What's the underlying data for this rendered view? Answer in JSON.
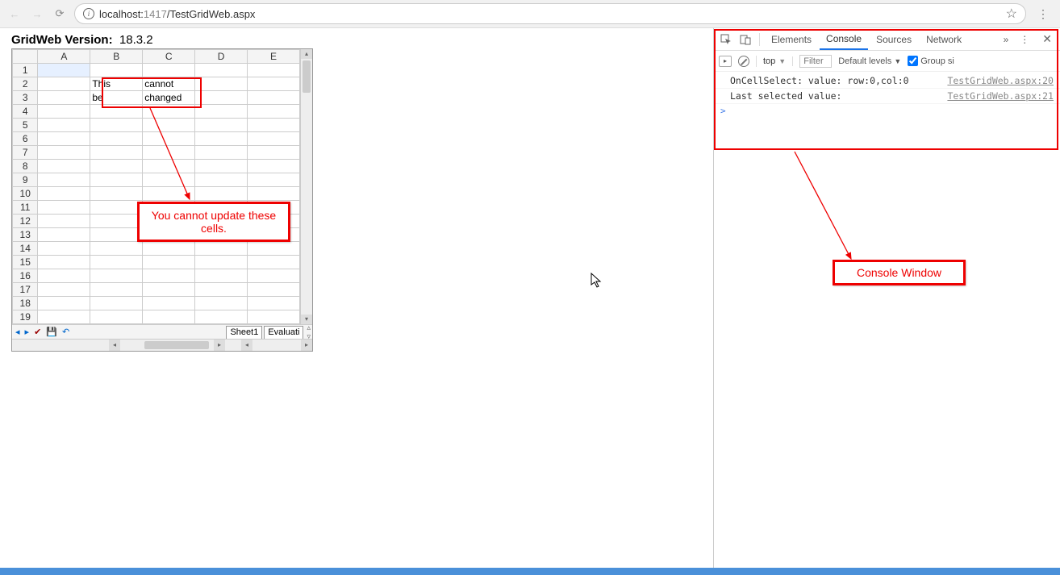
{
  "browser": {
    "url_host": "localhost:",
    "url_port": "1417",
    "url_path": "/TestGridWeb.aspx"
  },
  "page": {
    "version_label": "GridWeb Version:",
    "version_value": "18.3.2"
  },
  "grid": {
    "columns": [
      "A",
      "B",
      "C",
      "D",
      "E"
    ],
    "rows": [
      {
        "n": "1",
        "A": "",
        "B": "",
        "C": "",
        "D": "",
        "E": "",
        "sel": true
      },
      {
        "n": "2",
        "A": "",
        "B": "This",
        "C": "cannot",
        "D": "",
        "E": ""
      },
      {
        "n": "3",
        "A": "",
        "B": "be",
        "C": "changed",
        "D": "",
        "E": ""
      },
      {
        "n": "4"
      },
      {
        "n": "5"
      },
      {
        "n": "6"
      },
      {
        "n": "7"
      },
      {
        "n": "8"
      },
      {
        "n": "9"
      },
      {
        "n": "10"
      },
      {
        "n": "11"
      },
      {
        "n": "12"
      },
      {
        "n": "13"
      },
      {
        "n": "14"
      },
      {
        "n": "15"
      },
      {
        "n": "16"
      },
      {
        "n": "17"
      },
      {
        "n": "18"
      },
      {
        "n": "19"
      }
    ],
    "tabs": [
      "Sheet1",
      "Evaluati"
    ]
  },
  "annotations": {
    "cells_note": "You cannot update these cells.",
    "console_note": "Console  Window"
  },
  "devtools": {
    "tabs": [
      "Elements",
      "Console",
      "Sources",
      "Network"
    ],
    "active_tab": "Console",
    "context": "top",
    "filter_placeholder": "Filter",
    "levels_label": "Default levels",
    "group_label": "Group si",
    "log": [
      {
        "msg": "OnCellSelect: value: row:0,col:0",
        "src": "TestGridWeb.aspx:20"
      },
      {
        "msg": "Last selected value:",
        "src": "TestGridWeb.aspx:21"
      }
    ],
    "prompt": ">"
  }
}
